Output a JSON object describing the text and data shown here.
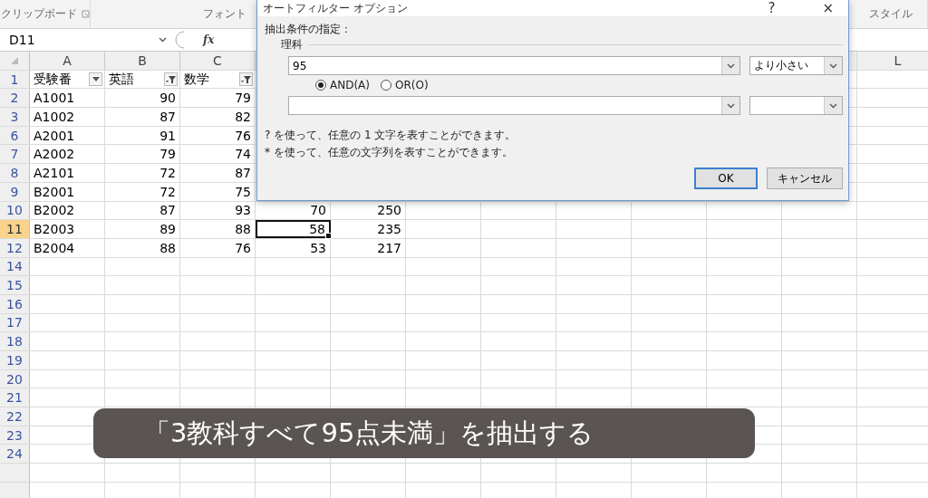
{
  "ribbon": {
    "groups": [
      {
        "label": "クリップボード",
        "launcher": true
      },
      {
        "label": "フォント",
        "launcher": false
      },
      {
        "label": "スタイル",
        "launcher": false
      }
    ]
  },
  "formula_bar": {
    "name_box": "D11",
    "fx_label": "fx"
  },
  "sheet": {
    "columns": [
      {
        "label": "A",
        "selected": false
      },
      {
        "label": "B",
        "selected": false
      },
      {
        "label": "C",
        "selected": false
      },
      {
        "label": "L",
        "selected": false
      }
    ],
    "header_row": {
      "num": "1",
      "cells": [
        {
          "text": "受験番",
          "filtered": false
        },
        {
          "text": "英語",
          "filtered": true
        },
        {
          "text": "数学",
          "filtered": true
        }
      ]
    },
    "rows": [
      {
        "num": "2",
        "selected": false,
        "cells": [
          {
            "text": "A1001",
            "active": false
          },
          {
            "text": "90",
            "active": false
          },
          {
            "text": "79",
            "active": false
          }
        ]
      },
      {
        "num": "3",
        "selected": false,
        "cells": [
          {
            "text": "A1002",
            "active": false
          },
          {
            "text": "87",
            "active": false
          },
          {
            "text": "82",
            "active": false
          }
        ]
      },
      {
        "num": "6",
        "selected": false,
        "cells": [
          {
            "text": "A2001",
            "active": false
          },
          {
            "text": "91",
            "active": false
          },
          {
            "text": "76",
            "active": false
          }
        ]
      },
      {
        "num": "7",
        "selected": false,
        "cells": [
          {
            "text": "A2002",
            "active": false
          },
          {
            "text": "79",
            "active": false
          },
          {
            "text": "74",
            "active": false
          }
        ]
      },
      {
        "num": "8",
        "selected": false,
        "cells": [
          {
            "text": "A2101",
            "active": false
          },
          {
            "text": "72",
            "active": false
          },
          {
            "text": "87",
            "active": false
          }
        ]
      },
      {
        "num": "9",
        "selected": false,
        "cells": [
          {
            "text": "B2001",
            "active": false
          },
          {
            "text": "72",
            "active": false
          },
          {
            "text": "75",
            "active": false
          }
        ]
      },
      {
        "num": "10",
        "selected": false,
        "cells": [
          {
            "text": "B2002",
            "active": false
          },
          {
            "text": "87",
            "active": false
          },
          {
            "text": "93",
            "active": false
          },
          {
            "text": "70",
            "active": false
          },
          {
            "text": "250",
            "active": false
          }
        ]
      },
      {
        "num": "11",
        "selected": true,
        "cells": [
          {
            "text": "B2003",
            "active": false
          },
          {
            "text": "89",
            "active": false
          },
          {
            "text": "88",
            "active": false
          },
          {
            "text": "58",
            "active": true
          },
          {
            "text": "235",
            "active": false
          }
        ]
      },
      {
        "num": "12",
        "selected": false,
        "cells": [
          {
            "text": "B2004",
            "active": false
          },
          {
            "text": "88",
            "active": false
          },
          {
            "text": "76",
            "active": false
          },
          {
            "text": "53",
            "active": false
          },
          {
            "text": "217",
            "active": false
          }
        ]
      },
      {
        "num": "14",
        "selected": false,
        "cells": []
      },
      {
        "num": "15",
        "selected": false,
        "cells": []
      },
      {
        "num": "16",
        "selected": false,
        "cells": []
      },
      {
        "num": "17",
        "selected": false,
        "cells": []
      },
      {
        "num": "18",
        "selected": false,
        "cells": []
      },
      {
        "num": "19",
        "selected": false,
        "cells": []
      },
      {
        "num": "20",
        "selected": false,
        "cells": []
      },
      {
        "num": "21",
        "selected": false,
        "cells": []
      },
      {
        "num": "22",
        "selected": false,
        "cells": []
      },
      {
        "num": "23",
        "selected": false,
        "cells": []
      },
      {
        "num": "24",
        "selected": false,
        "cells": []
      }
    ]
  },
  "dialog": {
    "title": "オートフィルター オプション",
    "help": "?",
    "close": "×",
    "section_label": "抽出条件の指定：",
    "field_label": "理科",
    "conditions": [
      {
        "kind": "filled",
        "value": "95",
        "operator": "より小さい"
      },
      {
        "kind": "blank"
      }
    ],
    "joins": [
      {
        "label": "AND(A)",
        "selected": true
      },
      {
        "label": "OR(O)",
        "selected": false
      }
    ],
    "hints": [
      "? を使って、任意の 1 文字を表すことができます。",
      "* を使って、任意の文字列を表すことができます。"
    ],
    "buttons": [
      {
        "label": "OK",
        "default": true
      },
      {
        "label": "キャンセル",
        "default": false
      }
    ]
  },
  "caption": "「3教科すべて95点未満」を抽出する"
}
